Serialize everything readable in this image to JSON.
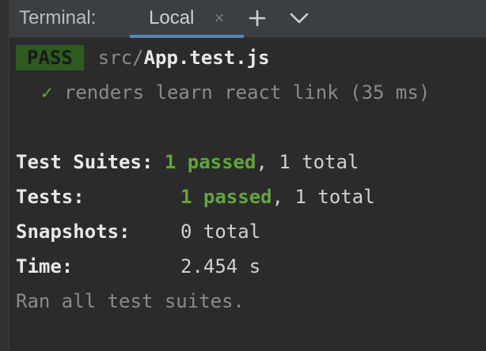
{
  "tabbar": {
    "title": "Terminal:",
    "tab_label": "Local",
    "tab_close_glyph": "×",
    "new_tab_icon": "plus-icon",
    "menu_icon": "chevron-down-icon"
  },
  "terminal": {
    "status_badge": "PASS",
    "file_prefix": "src/",
    "file_name": "App.test.js",
    "test_check": "✓",
    "test_name": "renders learn react link (35 ms)",
    "summary": {
      "suites_label": "Test Suites:",
      "suites_passed": "1 passed",
      "suites_total": ", 1 total",
      "tests_label": "Tests:",
      "tests_passed": "1 passed",
      "tests_total": ", 1 total",
      "snapshots_label": "Snapshots:",
      "snapshots_value": "0 total",
      "time_label": "Time:",
      "time_value": "2.454 s"
    },
    "footer": "Ran all test suites."
  },
  "colors": {
    "background": "#2b2b2b",
    "tabbar": "#3c3f41",
    "tab_underline": "#4a88c7",
    "pass_badge_bg": "#2e5b1e",
    "success_green": "#62a53a"
  }
}
